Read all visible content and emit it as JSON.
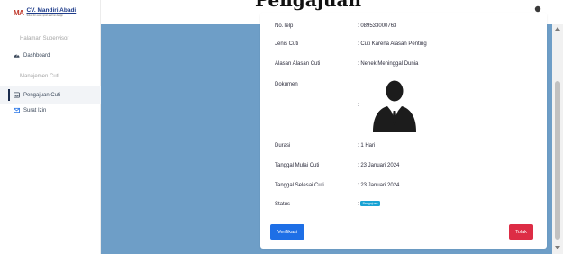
{
  "brand": {
    "logo": "MA",
    "name": "CV. Mandiri Abadi",
    "tagline": "Solusi for every sport and fun design"
  },
  "page": {
    "title_overlay": "Pengajuan"
  },
  "sidebar": {
    "heading_supervisor": "Halaman Supervisor",
    "heading_cuti": "Manajemen Cuti",
    "items": [
      {
        "label": "Dashboard",
        "icon": "dashboard-icon"
      },
      {
        "label": "Pengajuan Cuti",
        "icon": "inbox-icon"
      },
      {
        "label": "Surat Izin",
        "icon": "mail-icon"
      }
    ]
  },
  "detail": {
    "rows": [
      {
        "label": "No.Telp",
        "value": ": 089533000763"
      },
      {
        "label": "Jenis Cuti",
        "value": ": Cuti Karena Alasan Penting"
      },
      {
        "label": "Alasan Alasan Cuti",
        "value": ": Nenek Meninggal Dunia"
      },
      {
        "label": "Dokumen",
        "value": ":"
      },
      {
        "label": "Durasi",
        "value": ": 1 Hari"
      },
      {
        "label": "Tanggal Mulai Cuti",
        "value": ": 23 Januari 2024"
      },
      {
        "label": "Tanggal Selesai Cuti",
        "value": ": 23 Januari 2024"
      },
      {
        "label": "Status",
        "value": ":"
      }
    ],
    "status_badge": "Pengajuan"
  },
  "actions": {
    "verify_label": "Verifikasi",
    "reject_label": "Tolak"
  },
  "colors": {
    "main_bg": "#6e9ec7",
    "primary": "#1e6fe6",
    "danger": "#dd2c45",
    "badge": "#1aa3d4"
  }
}
